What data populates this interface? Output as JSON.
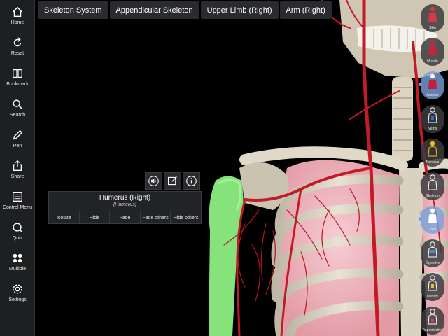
{
  "toolbar": {
    "items": [
      {
        "label": "Home"
      },
      {
        "label": "Reset"
      },
      {
        "label": "Bookmark"
      },
      {
        "label": "Search"
      },
      {
        "label": "Pen"
      },
      {
        "label": "Share"
      },
      {
        "label": "Control Menu"
      },
      {
        "label": "Quiz"
      },
      {
        "label": "Multiple"
      },
      {
        "label": "Settings"
      }
    ]
  },
  "breadcrumb": [
    "Skeleton System",
    "Appendicular Skeleton",
    "Upper Limb (Right)",
    "Arm (Right)"
  ],
  "structure": {
    "title": "Humerus (Right)",
    "subtitle": "(Humerus)",
    "actions": [
      "Isolate",
      "Hide",
      "Fade",
      "Fade others",
      "Hide others"
    ]
  },
  "layers": [
    {
      "label": "Skin",
      "color": "#d23a48"
    },
    {
      "label": "Muscle",
      "color": "#c0283c"
    },
    {
      "label": "Arteries",
      "color": "#c02040"
    },
    {
      "label": "Veins",
      "color": "#2e6ed8"
    },
    {
      "label": "Nervous",
      "color": "#e8c020"
    },
    {
      "label": "Skeleton",
      "color": "#e8e2d0"
    },
    {
      "label": "Joint",
      "color": "#5aa0ff"
    },
    {
      "label": "Digestive",
      "color": "#3a8fe0"
    },
    {
      "label": "Urinary",
      "color": "#e0c030"
    },
    {
      "label": "Reproductive",
      "color": "#d24060"
    }
  ],
  "colors": {
    "toolbar_bg": "#1e1f21",
    "bone": "#ddd6c6",
    "selected_bone": "#86e27a",
    "artery": "#c21a26",
    "lung": "#f0bcc4"
  }
}
